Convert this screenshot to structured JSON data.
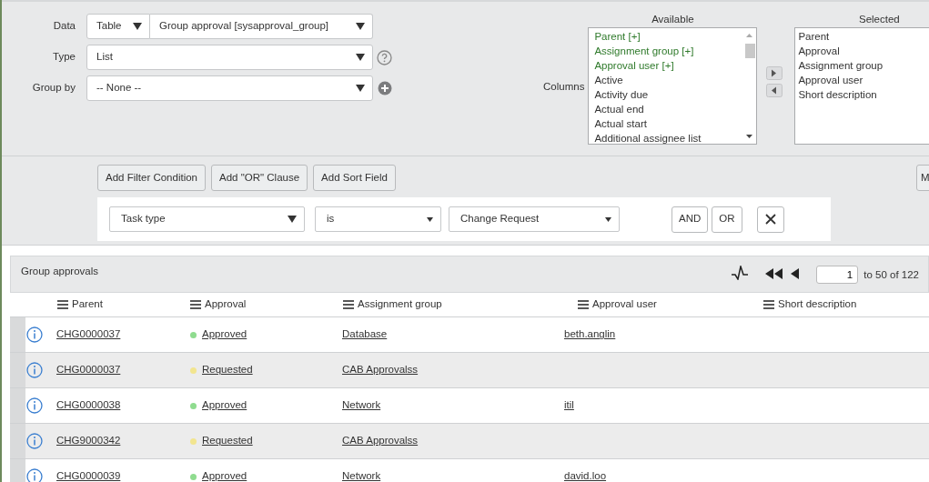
{
  "report_form": {
    "data": {
      "label": "Data",
      "source_type": "Table",
      "table": "Group approval [sysapproval_group]"
    },
    "type": {
      "label": "Type",
      "value": "List"
    },
    "group_by": {
      "label": "Group by",
      "value": "-- None --"
    },
    "columns": {
      "label": "Columns",
      "available_label": "Available",
      "selected_label": "Selected",
      "available": [
        {
          "text": "Parent [+]",
          "kind": "reference"
        },
        {
          "text": "Assignment group [+]",
          "kind": "reference"
        },
        {
          "text": "Approval user [+]",
          "kind": "reference"
        },
        {
          "text": "Active",
          "kind": "field"
        },
        {
          "text": "Activity due",
          "kind": "field"
        },
        {
          "text": "Actual end",
          "kind": "field"
        },
        {
          "text": "Actual start",
          "kind": "field"
        },
        {
          "text": "Additional assignee list",
          "kind": "field"
        }
      ],
      "selected": [
        "Parent",
        "Approval",
        "Assignment group",
        "Approval user",
        "Short description"
      ]
    }
  },
  "filter": {
    "buttons": [
      "Add Filter Condition",
      "Add \"OR\" Clause",
      "Add Sort Field"
    ],
    "right_button": "M",
    "condition": {
      "field": "Task type",
      "operator": "is",
      "value": "Change Request"
    },
    "condition_buttons": [
      "AND",
      "OR"
    ]
  },
  "list": {
    "title": "Group approvals",
    "page_input": "1",
    "page_text": "to 50 of 122",
    "columns": [
      "Parent",
      "Approval",
      "Assignment group",
      "Approval user",
      "Short description"
    ],
    "rows": [
      {
        "parent": "CHG0000037",
        "approval": "Approved",
        "color": "#8fdc8f",
        "group": "Database",
        "user": "beth.anglin"
      },
      {
        "parent": "CHG0000037",
        "approval": "Requested",
        "color": "#f2e58f",
        "group": "CAB Approvalss",
        "user": ""
      },
      {
        "parent": "CHG0000038",
        "approval": "Approved",
        "color": "#8fdc8f",
        "group": "Network",
        "user": "itil"
      },
      {
        "parent": "CHG9000342",
        "approval": "Requested",
        "color": "#f2e58f",
        "group": "CAB Approvalss",
        "user": ""
      },
      {
        "parent": "CHG0000039",
        "approval": "Approved",
        "color": "#8fdc8f",
        "group": "Network",
        "user": "david.loo"
      }
    ]
  }
}
